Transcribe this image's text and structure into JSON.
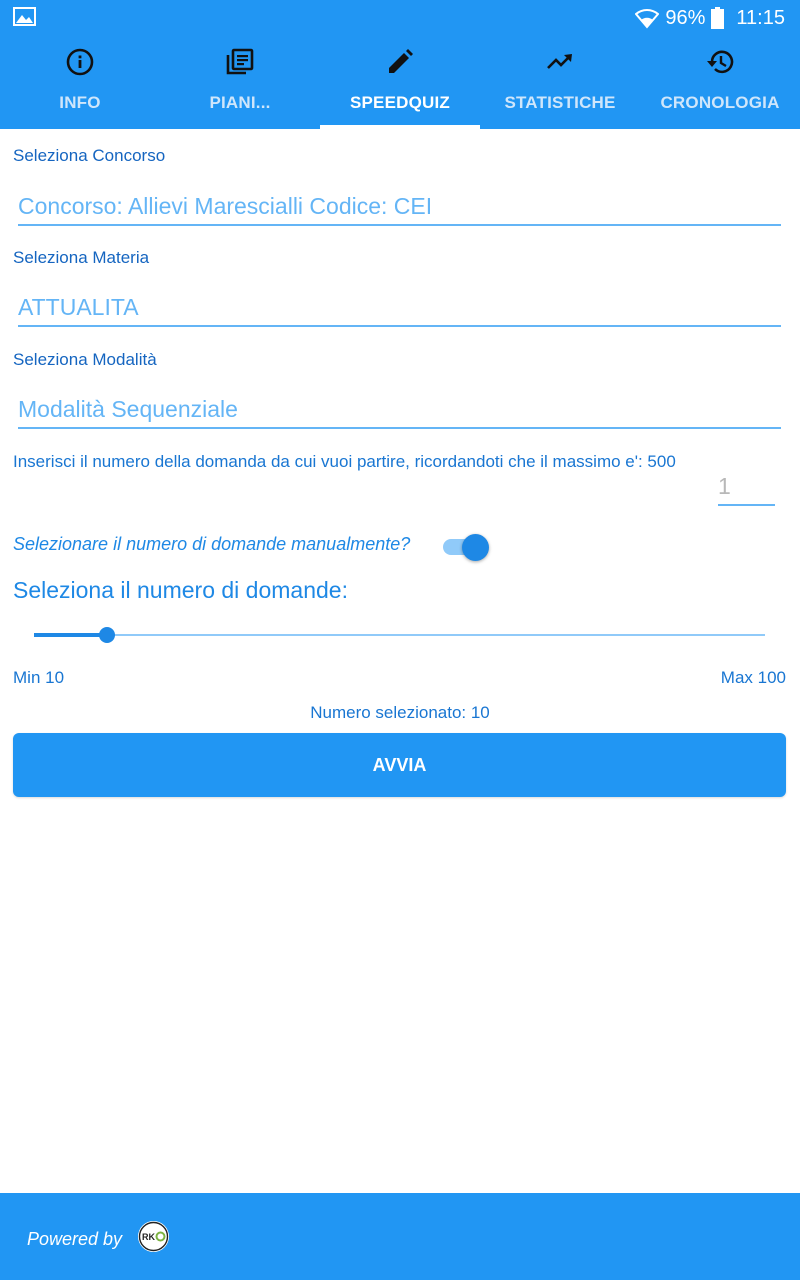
{
  "status": {
    "battery": "96%",
    "time": "11:15",
    "icons": [
      "gallery-icon",
      "wifi-icon",
      "battery-icon"
    ]
  },
  "tabs": [
    {
      "label": "INFO",
      "icon": "info-icon"
    },
    {
      "label": "PIANI...",
      "icon": "library-books-icon"
    },
    {
      "label": "SPEEDQUIZ",
      "icon": "pencil-icon"
    },
    {
      "label": "STATISTICHE",
      "icon": "trending-up-icon"
    },
    {
      "label": "CRONOLOGIA",
      "icon": "history-icon"
    }
  ],
  "active_tab": "SPEEDQUIZ",
  "form": {
    "concorso_label": "Seleziona Concorso",
    "concorso_value": "Concorso: Allievi Marescialli  Codice: CEI",
    "materia_label": "Seleziona Materia",
    "materia_value": "ATTUALITA",
    "modalita_label": "Seleziona Modalità",
    "modalita_value": "Modalità Sequenziale",
    "start_question_text": "Inserisci il numero della domanda da cui vuoi partire, ricordandoti che il  massimo e': 500",
    "start_question_placeholder": "1",
    "manual_question": "Selezionare il numero di domande manualmente?",
    "manual_toggle_on": true,
    "count_heading": "Seleziona il numero di domande:",
    "slider": {
      "min": 10,
      "max": 100,
      "value": 10
    },
    "min_label": "Min 10",
    "max_label": "Max 100",
    "selected_text": "Numero selezionato: 10",
    "start_button": "AVVIA"
  },
  "footer": {
    "powered_by": "Powered by",
    "logo_text": "RK"
  },
  "colors": {
    "primary": "#2196F3",
    "accent": "#1E88E5",
    "field_text": "#64B5F6"
  }
}
